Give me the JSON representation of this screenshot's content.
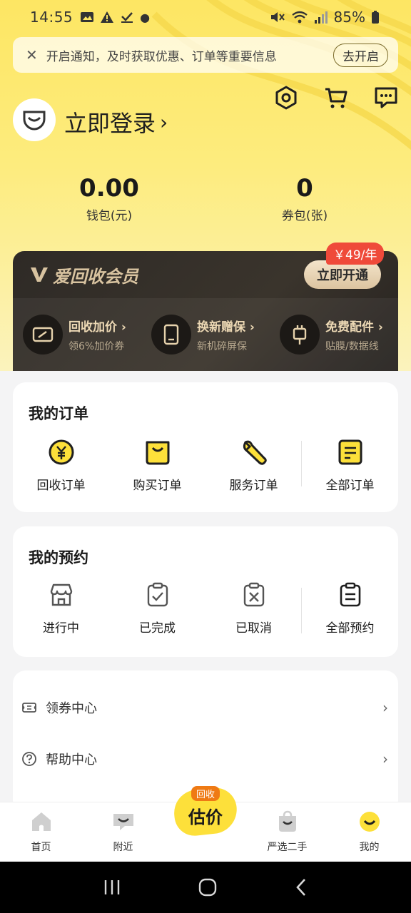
{
  "status_bar": {
    "time": "14:55",
    "battery": "85%"
  },
  "notification": {
    "message": "开启通知，及时获取优惠、订单等重要信息",
    "action": "去开启"
  },
  "header": {
    "login": "立即登录",
    "login_chevron": "›"
  },
  "wallet": {
    "value": "0.00",
    "label": "钱包(元)"
  },
  "coupons": {
    "value": "0",
    "label": "券包(张)"
  },
  "vip": {
    "brand": "爱回收会员",
    "price": "￥49/年",
    "open": "立即开通",
    "perks": [
      {
        "title": "回收加价 ›",
        "sub": "领6%加价券"
      },
      {
        "title": "换新赠保 ›",
        "sub": "新机碎屏保"
      },
      {
        "title": "免费配件 ›",
        "sub": "贴膜/数据线"
      }
    ]
  },
  "orders": {
    "title": "我的订单",
    "items": [
      "回收订单",
      "购买订单",
      "服务订单",
      "全部订单"
    ]
  },
  "appointments": {
    "title": "我的预约",
    "items": [
      "进行中",
      "已完成",
      "已取消",
      "全部预约"
    ]
  },
  "menu": [
    {
      "label": "领券中心",
      "arrow": "›"
    },
    {
      "label": "帮助中心",
      "arrow": "›"
    }
  ],
  "tabs": {
    "home": "首页",
    "nearby": "附近",
    "center_badge": "回收",
    "center_label": "估价",
    "selected": "严选二手",
    "mine": "我的"
  },
  "colors": {
    "accent": "#fde03a",
    "vip_bg": "#2e2a26",
    "price_tag": "#ef4a3a"
  }
}
